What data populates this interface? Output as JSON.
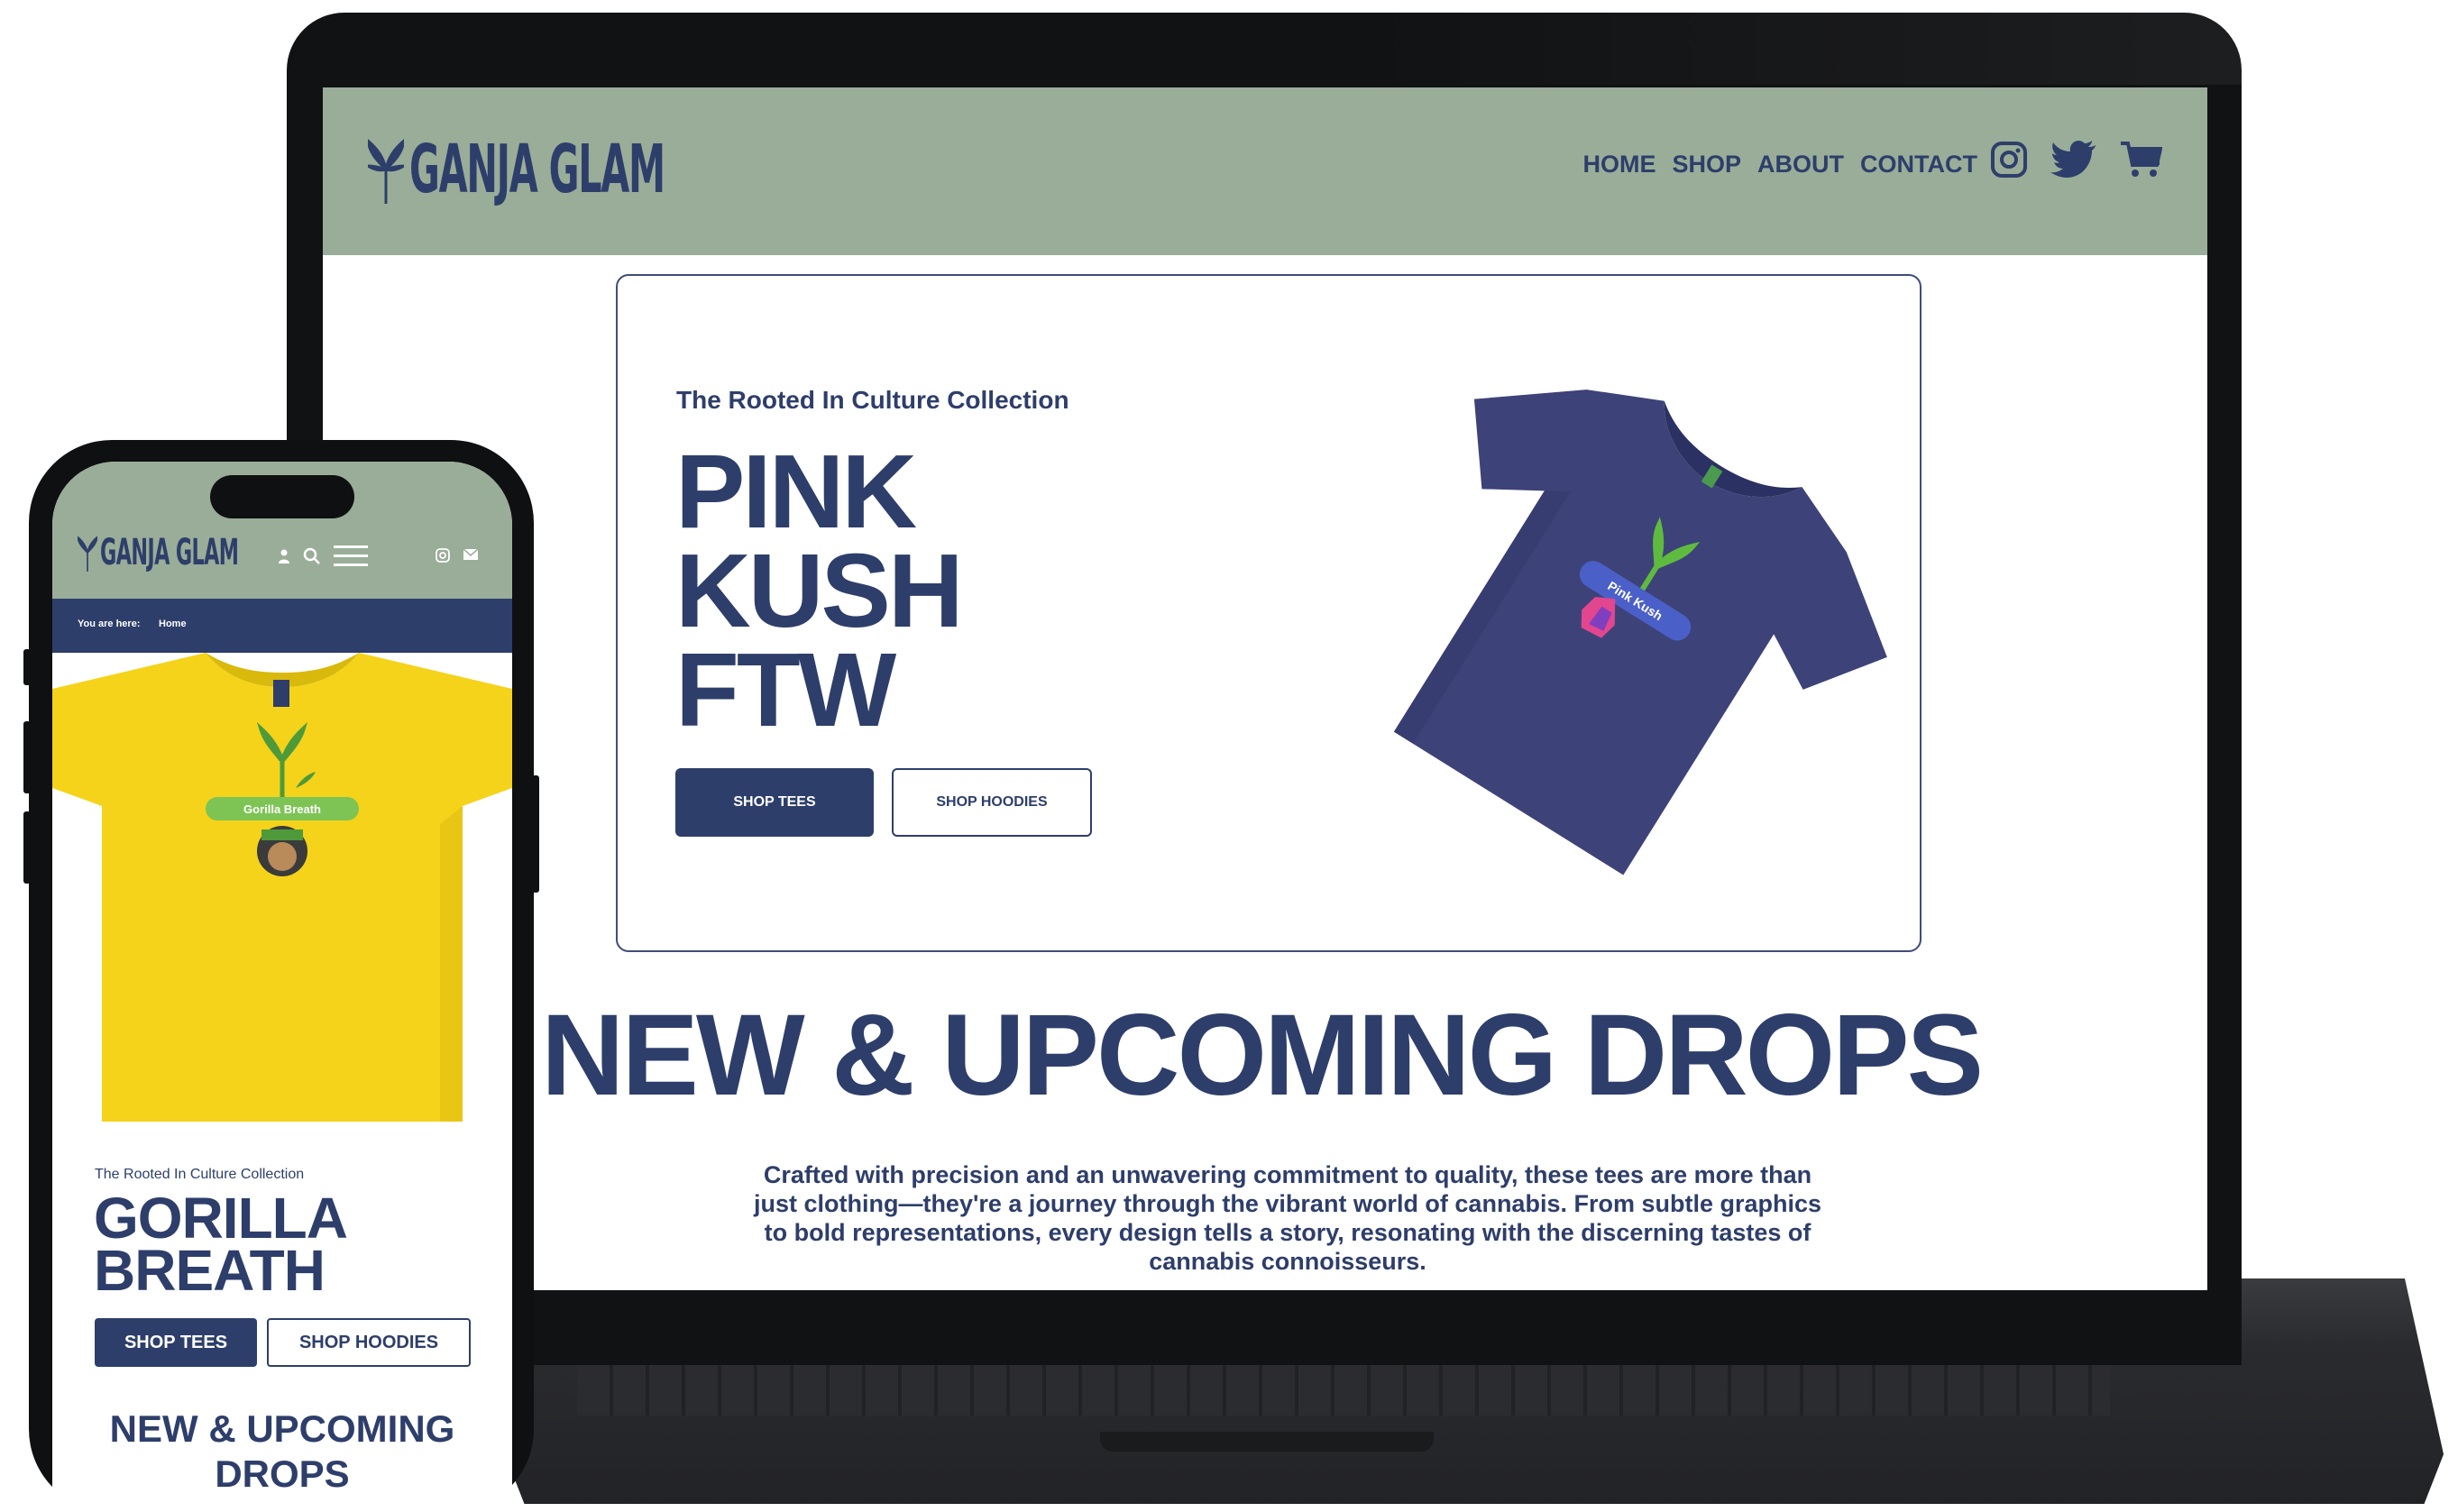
{
  "colors": {
    "navy": "#2e3e6b",
    "sage": "#9aad98",
    "tee_blue": "#3d4378",
    "tee_yellow": "#f4d31a"
  },
  "brand": {
    "logo_text": "GANJA GLAM"
  },
  "desktop": {
    "nav": [
      "HOME",
      "SHOP",
      "ABOUT",
      "CONTACT"
    ],
    "header_icons": [
      "instagram-icon",
      "twitter-icon",
      "cart-icon"
    ],
    "hero": {
      "subtitle": "The Rooted In Culture Collection",
      "title_lines": [
        "PINK",
        "KUSH",
        "FTW"
      ],
      "primary_button": "SHOP TEES",
      "secondary_button": "SHOP HOODIES",
      "product_label": "Pink Kush"
    },
    "section_heading": "NEW & UPCOMING DROPS",
    "description": "Crafted with precision and an unwavering commitment to quality, these tees are more than just clothing—they're a journey through the vibrant world of cannabis. From subtle graphics to bold representations, every design tells a story, resonating with the discerning tastes of cannabis connoisseurs."
  },
  "mobile": {
    "breadcrumb_label": "You are here:",
    "breadcrumb_current": "Home",
    "header_icons": [
      "user-icon",
      "search-icon",
      "menu-icon",
      "instagram-icon",
      "mail-icon"
    ],
    "hero": {
      "subtitle": "The Rooted In Culture Collection",
      "title_lines": [
        "GORILLA",
        "BREATH"
      ],
      "primary_button": "SHOP TEES",
      "secondary_button": "SHOP HOODIES",
      "product_label": "Gorilla Breath"
    },
    "section_heading_lines": [
      "NEW & UPCOMING",
      "DROPS"
    ]
  }
}
